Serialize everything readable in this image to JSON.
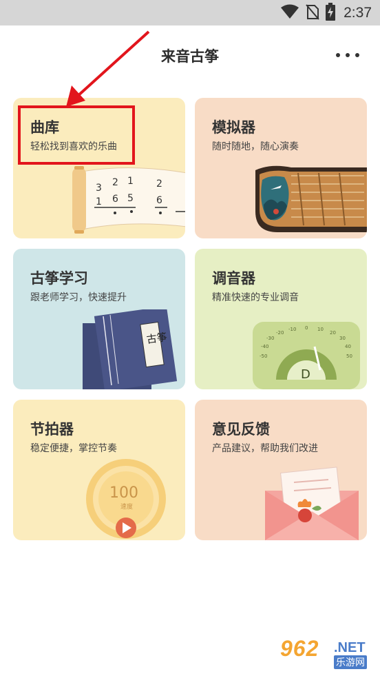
{
  "status_bar": {
    "time": "2:37",
    "icons": [
      "wifi-icon",
      "no-sim-icon",
      "battery-charging-icon"
    ]
  },
  "header": {
    "title": "来音古筝",
    "more_icon": "more-dots-icon"
  },
  "cards": [
    {
      "id": "library",
      "title": "曲库",
      "subtitle": "轻松找到喜欢的乐曲",
      "bg": "#fbecbd",
      "art_text": {
        "row1": [
          "3",
          "2",
          "1",
          "2"
        ],
        "row2": [
          "1",
          "6",
          "5",
          "6"
        ]
      }
    },
    {
      "id": "simulator",
      "title": "模拟器",
      "subtitle": "随时随地，随心演奏",
      "bg": "#f8dcc6"
    },
    {
      "id": "learn",
      "title": "古筝学习",
      "subtitle": "跟老师学习，快速提升",
      "bg": "#cfe6e8",
      "art_text": {
        "book_label": "古筝"
      }
    },
    {
      "id": "tuner",
      "title": "调音器",
      "subtitle": "精准快速的专业调音",
      "bg": "#e6efc4",
      "art_text": {
        "note": "D",
        "scale": [
          "-50",
          "-40",
          "-30",
          "-20",
          "-10",
          "0",
          "10",
          "20",
          "30",
          "40",
          "50"
        ]
      }
    },
    {
      "id": "metronome",
      "title": "节拍器",
      "subtitle": "稳定便捷，掌控节奏",
      "bg": "#fbecbd",
      "art_text": {
        "bpm": "100",
        "bpm_label": "速度"
      }
    },
    {
      "id": "feedback",
      "title": "意见反馈",
      "subtitle": "产品建议，帮助我们改进",
      "bg": "#f8dcc6"
    }
  ],
  "annotation": {
    "color": "#e2151c"
  },
  "watermark": {
    "num": "962",
    "net": ".NET",
    "cn": "乐游网"
  }
}
